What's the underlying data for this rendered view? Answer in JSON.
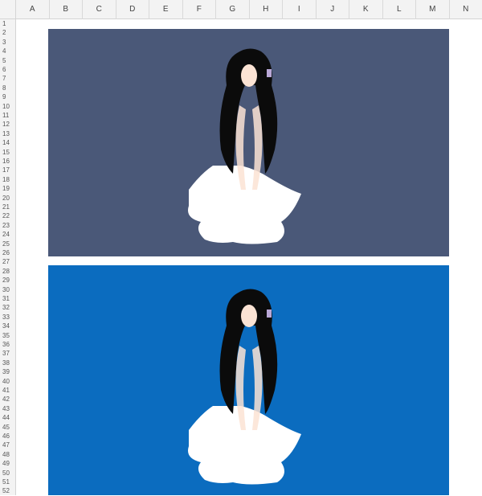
{
  "columns": [
    "A",
    "B",
    "C",
    "D",
    "E",
    "F",
    "G",
    "H",
    "I",
    "J",
    "K",
    "L",
    "M",
    "N"
  ],
  "rows": [
    "1",
    "2",
    "3",
    "4",
    "5",
    "6",
    "7",
    "8",
    "9",
    "10",
    "11",
    "12",
    "13",
    "14",
    "15",
    "16",
    "17",
    "18",
    "19",
    "20",
    "21",
    "22",
    "23",
    "24",
    "25",
    "26",
    "27",
    "28",
    "29",
    "30",
    "31",
    "32",
    "33",
    "34",
    "35",
    "36",
    "37",
    "38",
    "39",
    "40",
    "41",
    "42",
    "43",
    "44",
    "45",
    "46",
    "47",
    "48",
    "49",
    "50",
    "51",
    "52"
  ],
  "images": [
    {
      "background": "#4a5878"
    },
    {
      "background": "#0b6cbf"
    }
  ]
}
